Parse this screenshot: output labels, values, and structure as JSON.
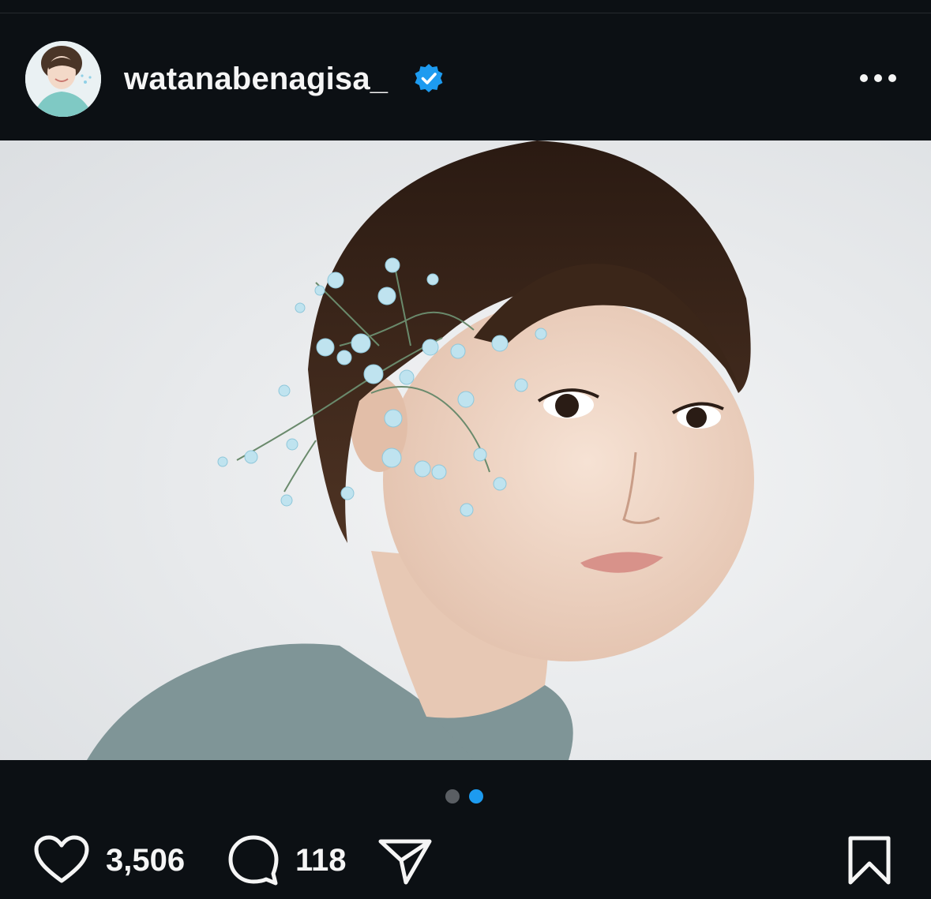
{
  "post": {
    "username": "watanabenagisa_",
    "verified": true,
    "verified_color": "#1d9bf0",
    "icons": {
      "verified": "verified-badge-icon",
      "more": "more-options-icon",
      "like": "heart-icon",
      "comment": "comment-bubble-icon",
      "share": "paper-plane-icon",
      "save": "bookmark-icon"
    },
    "carousel": {
      "total": 2,
      "current": 2,
      "active_color": "#1d9bf0"
    },
    "likes": "3,506",
    "comments": "118"
  }
}
